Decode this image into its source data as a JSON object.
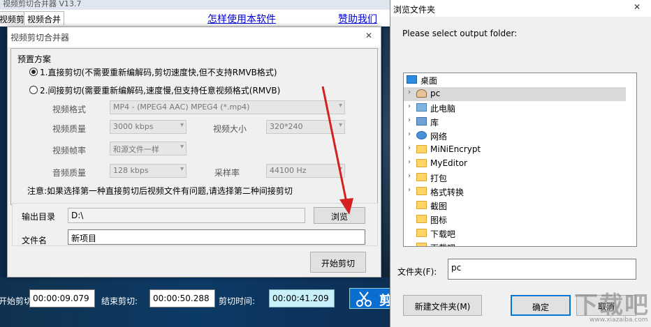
{
  "main_window": {
    "title": "视频剪切合并器 V13.7",
    "tabs": [
      "视频剪切",
      "视频合并"
    ],
    "links": [
      "怎样使用本软件",
      "赞助我们"
    ],
    "start_cut_label": "开始剪切:",
    "start_cut_value": "00:00:09.079",
    "end_cut_label": "结束剪切:",
    "end_cut_value": "00:00:50.288",
    "cut_time_label": "剪切时间:",
    "cut_time_value": "00:00:41.209",
    "cut_button_glyph": "剪"
  },
  "merge_dialog": {
    "title": "视频剪切合并器",
    "preset_group": "预置方案",
    "option1": "1.直接剪切(不需要重新编解码,剪切速度快,但不支持RMVB格式)",
    "option2": "2.间接剪切(需要重新编解码,速度慢,但支持任意视频格式(RMVB)",
    "selected_option": 1,
    "video_format_label": "视频格式",
    "video_format_value": "MP4 - (MPEG4 AAC) MPEG4 (*.mp4)",
    "video_quality_label": "视频质量",
    "video_quality_value": "3000 kbps",
    "video_size_label": "视频大小",
    "video_size_value": "320*240",
    "frame_rate_label": "视频帧率",
    "frame_rate_value": "和源文件一样",
    "audio_quality_label": "音频质量",
    "audio_quality_value": "128 kbps",
    "sample_rate_label": "采样率",
    "sample_rate_value": "44100 Hz",
    "note": "注意:如果选择第一种直接剪切后视频文件有问题,请选择第二种间接剪切",
    "output_dir_label": "输出目录",
    "output_dir_value": "D:\\",
    "browse_button": "浏览",
    "filename_label": "文件名",
    "filename_value": "新项目",
    "start_button": "开始剪切"
  },
  "browse_dialog": {
    "title": "浏览文件夹",
    "prompt": "Please select output folder:",
    "tree": [
      {
        "label": "桌面",
        "icon": "desktop-icon",
        "arrow": ""
      },
      {
        "label": "pc",
        "icon": "user-icon",
        "arrow": "›"
      },
      {
        "label": "此电脑",
        "icon": "computer-icon",
        "arrow": "›"
      },
      {
        "label": "库",
        "icon": "library-icon",
        "arrow": "›"
      },
      {
        "label": "网络",
        "icon": "network-icon",
        "arrow": "›"
      },
      {
        "label": "MiNiEncrypt",
        "icon": "folder-icon",
        "arrow": "›"
      },
      {
        "label": "MyEditor",
        "icon": "folder-icon",
        "arrow": "›"
      },
      {
        "label": "打包",
        "icon": "folder-icon",
        "arrow": "›"
      },
      {
        "label": "格式转换",
        "icon": "folder-icon",
        "arrow": "›"
      },
      {
        "label": "截图",
        "icon": "folder-icon",
        "arrow": ""
      },
      {
        "label": "图标",
        "icon": "folder-icon",
        "arrow": ""
      },
      {
        "label": "下载吧",
        "icon": "folder-icon",
        "arrow": ""
      },
      {
        "label": "下载吧",
        "icon": "folder-icon",
        "arrow": ""
      }
    ],
    "selected_index": 1,
    "folder_label": "文件夹(F):",
    "folder_value": "pc",
    "new_folder_button": "新建文件夹(M)",
    "ok_button": "确定",
    "cancel_button": "取消"
  },
  "watermark": {
    "text": "下载吧",
    "sub": "www.xiazaiba.com"
  },
  "colors": {
    "link": "#0000d8",
    "annotation": "#d42020",
    "focus_border": "#0078d7"
  }
}
